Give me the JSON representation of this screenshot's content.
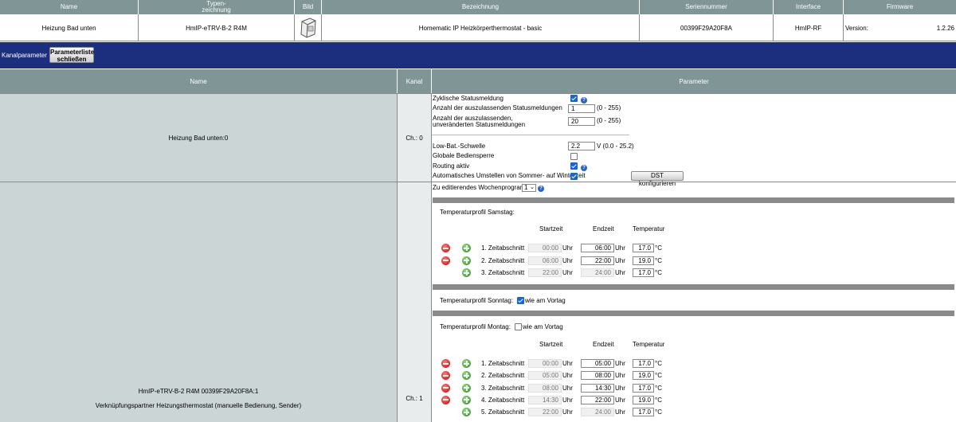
{
  "header": {
    "name": "Name",
    "typ": "Typen-\nzeichnung",
    "bild": "Bild",
    "bezeichnung": "Bezeichnung",
    "seriennummer": "Seriennummer",
    "interface": "Interface",
    "firmware": "Firmware"
  },
  "device": {
    "name": "Heizung Bad unten",
    "typ": "HmIP-eTRV-B-2 R4M",
    "bezeichnung": "Homematic IP Heizkörperthermostat - basic",
    "seriennummer": "00399F29A20F8A",
    "interface": "HmIP-RF",
    "version_label": "Version:",
    "version": "1.2.26"
  },
  "toolbar": {
    "kanalparameter": "Kanalparameter",
    "close_button": "Parameterliste schließen"
  },
  "columns": {
    "name": "Name",
    "kanal": "Kanal",
    "parameter": "Parameter"
  },
  "channel0": {
    "name": "Heizung Bad unten:0",
    "kanal": "Ch.: 0",
    "params": {
      "zyklisch": "Zyklische Statusmeldung",
      "anzahl": "Anzahl der auszulassenden Statusmeldungen",
      "anzahl_value": "1",
      "anzahl_range": "(0 - 255)",
      "anzahl_unver_1": "Anzahl der auszulassenden,",
      "anzahl_unver_2": "unveränderten Statusmeldungen",
      "anzahl_unver_value": "20",
      "anzahl_unver_range": "(0 - 255)",
      "lowbat": "Low-Bat.-Schwelle",
      "lowbat_value": "2.2",
      "lowbat_range": "V (0.0 - 25.2)",
      "sperre": "Globale Bediensperre",
      "routing": "Routing aktiv",
      "sommer": "Automatisches Umstellen von Sommer- auf Winterzeit",
      "dst_button": "DST konfigurieren"
    }
  },
  "channel1": {
    "name_1": "HmIP-eTRV-B-2 R4M 00399F29A20F8A:1",
    "name_2": "Verknüpfungspartner Heizungsthermostat (manuelle Bedienung, Sender)",
    "kanal": "Ch.: 1",
    "wochenprogramm_label": "Zu editierendes Wochenprogramm:",
    "wochenprogramm_value": "1",
    "col_start": "Startzeit",
    "col_end": "Endzeit",
    "col_temp": "Temperatur",
    "uhr": "Uhr",
    "celsius": "°C",
    "samstag": {
      "title": "Temperaturprofil Samstag:",
      "rows": [
        {
          "label": "1. Zeitabschnitt",
          "start": "00:00",
          "end": "06:00",
          "temp": "17.0"
        },
        {
          "label": "2. Zeitabschnitt",
          "start": "06:00",
          "end": "22:00",
          "temp": "19.0"
        },
        {
          "label": "3. Zeitabschnitt",
          "start": "22:00",
          "end": "24:00",
          "temp": "17.0"
        }
      ]
    },
    "sonntag": {
      "title": "Temperaturprofil Sonntag:",
      "wie_am_vortag": "wie am Vortag"
    },
    "montag": {
      "title": "Temperaturprofil Montag:",
      "wie_am_vortag": "wie am Vortag",
      "rows": [
        {
          "label": "1. Zeitabschnitt",
          "start": "00:00",
          "end": "05:00",
          "temp": "17.0"
        },
        {
          "label": "2. Zeitabschnitt",
          "start": "05:00",
          "end": "08:00",
          "temp": "19.0"
        },
        {
          "label": "3. Zeitabschnitt",
          "start": "08:00",
          "end": "14:30",
          "temp": "17.0"
        },
        {
          "label": "4. Zeitabschnitt",
          "start": "14:30",
          "end": "22:00",
          "temp": "19.0"
        },
        {
          "label": "5. Zeitabschnitt",
          "start": "22:00",
          "end": "24:00",
          "temp": "17.0"
        }
      ]
    }
  }
}
